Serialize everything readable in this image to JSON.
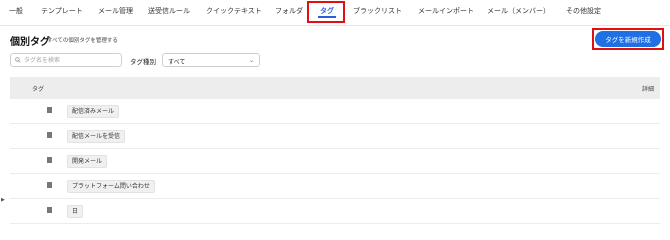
{
  "nav": {
    "tabs": [
      {
        "label": "一般"
      },
      {
        "label": "テンプレート"
      },
      {
        "label": "メール管理"
      },
      {
        "label": "送受信ルール"
      },
      {
        "label": "クイックテキスト"
      },
      {
        "label": "フォルダ"
      },
      {
        "label": "タグ",
        "active": true
      },
      {
        "label": "ブラックリスト"
      },
      {
        "label": "メールインポート"
      },
      {
        "label": "メール（メンバー）"
      },
      {
        "label": "その他設定"
      }
    ]
  },
  "header": {
    "title": "個別タグ",
    "subtitle": "すべての個別タグを管理する",
    "create_button": "タグを新規作成"
  },
  "filters": {
    "search_placeholder": "タグ名を検索",
    "type_label": "タグ種別",
    "type_value": "すべて"
  },
  "table": {
    "columns": {
      "tag": "タグ",
      "detail": "詳細"
    },
    "rows": [
      {
        "name": "配信済みメール"
      },
      {
        "name": "配信メールを受信"
      },
      {
        "name": "開発メール"
      },
      {
        "name": "プラットフォーム問い合わせ"
      },
      {
        "name": "日"
      }
    ]
  },
  "colors": {
    "accent": "#1f6fe5",
    "highlight_box": "#e01010",
    "active_tab": "#2b5fd9"
  },
  "icons": {
    "search": "search-icon",
    "tag": "tag-icon",
    "select": "chevron-down-icon"
  }
}
